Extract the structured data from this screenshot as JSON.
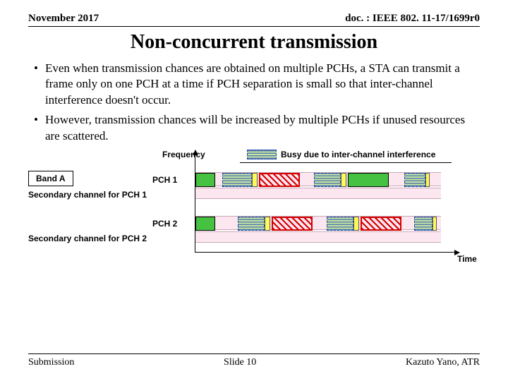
{
  "header": {
    "date": "November 2017",
    "doc": "doc. : IEEE 802. 11-17/1699r0"
  },
  "title": "Non-concurrent transmission",
  "bullets": [
    "Even when transmission chances are obtained on multiple PCHs, a STA can transmit a frame only on one PCH at a time if PCH separation is small so that inter-channel interference doesn't occur.",
    "However, transmission chances will be increased by multiple PCHs if unused resources are scattered."
  ],
  "diagram": {
    "freq_label": "Frequency",
    "time_label": "Time",
    "band_a": "Band A",
    "pch1": "PCH 1",
    "pch2": "PCH 2",
    "sec1": "Secondary channel for PCH 1",
    "sec2": "Secondary channel for PCH 2",
    "legend": "Busy due to inter-channel interference"
  },
  "footer": {
    "left": "Submission",
    "center": "Slide 10",
    "right": "Kazuto Yano, ATR"
  }
}
